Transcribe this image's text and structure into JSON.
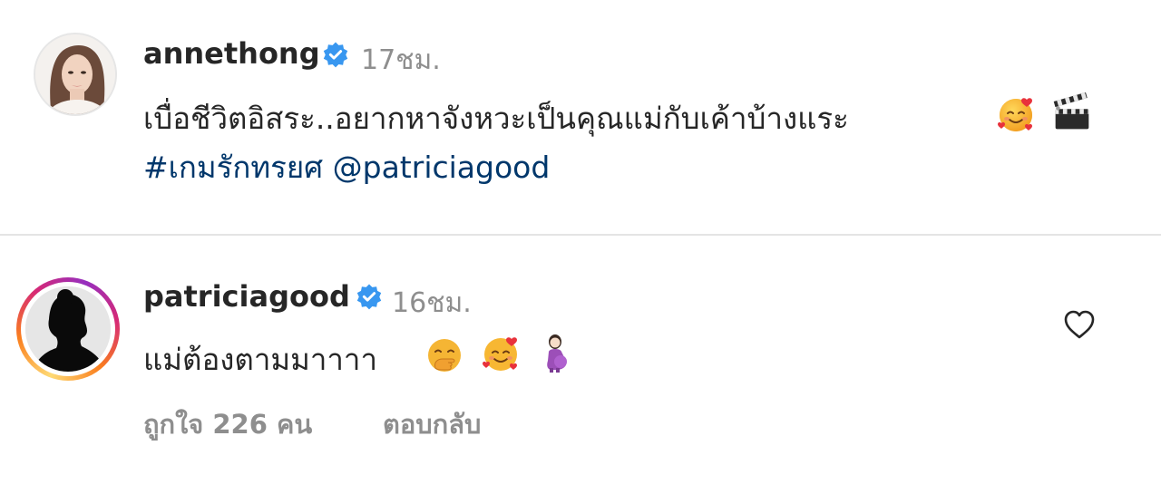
{
  "post": {
    "username": "annethong",
    "time": "17ชม.",
    "caption_line1": "เบื่อชีวิตอิสระ..อยากหาจังหวะเป็นคุณแม่กับเค้าบ้างแระ",
    "hashtag": "#เกมรักทรยศ",
    "mention": "@patriciagood",
    "emoji_1": "smiling-face-with-hearts-icon",
    "emoji_2": "clapper-board-icon"
  },
  "comment": {
    "username": "patriciagood",
    "time": "16ชม.",
    "text": "แม่ต้องตามมาาาา",
    "likes": "ถูกใจ 226 คน",
    "reply_label": "ตอบกลับ",
    "emoji_1": "hand-over-mouth-icon",
    "emoji_2": "smiling-face-with-hearts-icon",
    "emoji_3": "pregnant-woman-icon"
  },
  "colors": {
    "text": "#262626",
    "secondary": "#8e8e8e",
    "link": "#00376b",
    "verified": "#3897f0",
    "divider": "#e4e4e4"
  }
}
